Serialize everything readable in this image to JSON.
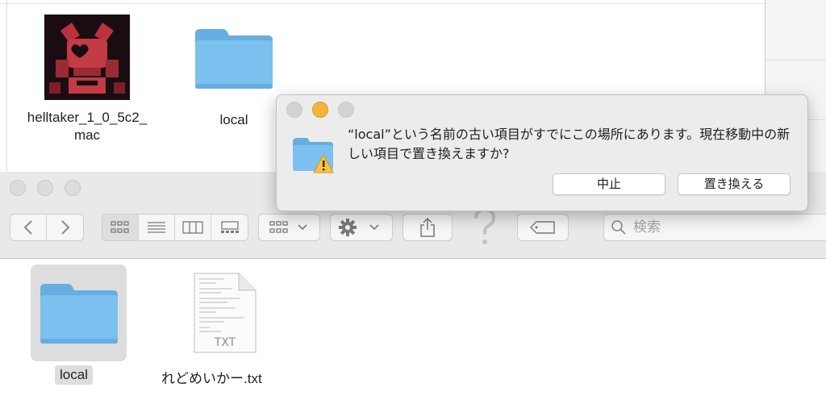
{
  "background_window": {
    "files": [
      {
        "name": "helltaker_1_0_5c2_mac",
        "name_line1": "helltaker_1_0_5c2_",
        "name_line2": "mac",
        "icon": "app-icon"
      },
      {
        "name": "local",
        "icon": "folder-icon"
      }
    ]
  },
  "toolbar": {
    "back_icon": "chevron-left-icon",
    "forward_icon": "chevron-right-icon",
    "view_modes": [
      "icon-view-icon",
      "list-view-icon",
      "column-view-icon",
      "gallery-view-icon"
    ],
    "group_icon": "group-icon",
    "action_icon": "gear-icon",
    "share_icon": "share-icon",
    "help_icon": "question-icon",
    "tag_icon": "tag-icon",
    "search": {
      "placeholder": "検索"
    }
  },
  "foreground_window": {
    "files": [
      {
        "name": "local",
        "icon": "folder-icon",
        "selected": true
      },
      {
        "name": "れどめいかー.txt",
        "icon": "txt-file-icon",
        "badge": "TXT"
      }
    ]
  },
  "alert": {
    "message": "“local”という名前の古い項目がすでにこの場所にあります。現在移動中の新しい項目で置き換えますか?",
    "cancel_label": "中止",
    "replace_label": "置き換える"
  },
  "colors": {
    "folder": "#6fb6ea",
    "minimize_light": "#f5b33a",
    "inactive_light": "#cfcfcf"
  }
}
